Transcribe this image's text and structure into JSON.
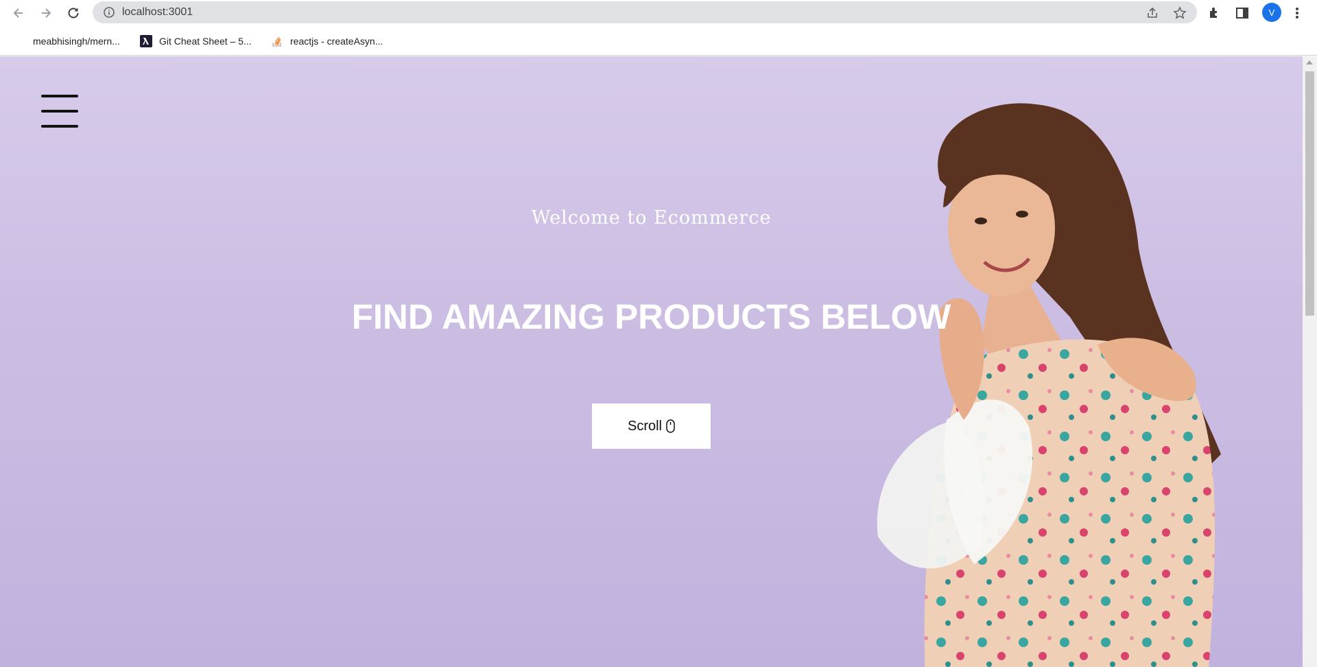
{
  "browser": {
    "url": "localhost:3001",
    "profile_initial": "V",
    "accent_color": "#1a73e8",
    "bookmarks": [
      {
        "label": "meabhisingh/mern...",
        "icon": "github-icon"
      },
      {
        "label": "Git Cheat Sheet – 5...",
        "icon": "lambda-icon"
      },
      {
        "label": "reactjs - createAsyn...",
        "icon": "stackoverflow-icon"
      }
    ]
  },
  "hero": {
    "welcome_text": "Welcome to Ecommerce",
    "headline": "FIND AMAZING PRODUCTS BELOW",
    "scroll_label": "Scroll",
    "background_color": "#cbbde2"
  }
}
